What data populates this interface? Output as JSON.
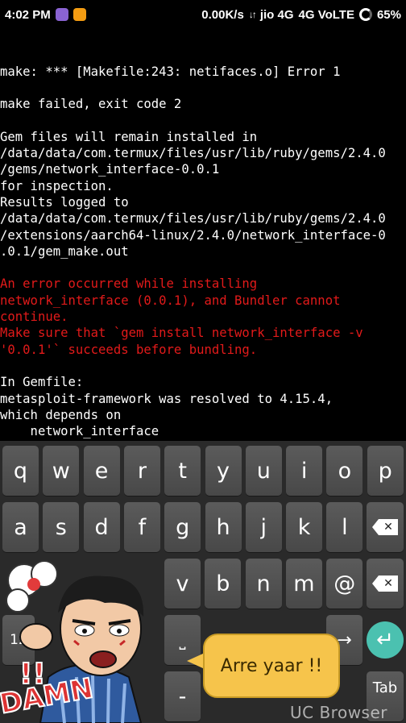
{
  "status_bar": {
    "time": "4:02 PM",
    "net_speed": "0.00K/s",
    "carrier": "jio 4G",
    "network": "4G VoLTE",
    "battery": "65%"
  },
  "terminal": {
    "lines": [
      {
        "text": "make: *** [Makefile:243: netifaces.o] Error 1",
        "style": "normal"
      },
      {
        "text": "",
        "style": "normal"
      },
      {
        "text": "make failed, exit code 2",
        "style": "normal"
      },
      {
        "text": "",
        "style": "normal"
      },
      {
        "text": "Gem files will remain installed in",
        "style": "normal"
      },
      {
        "text": "/data/data/com.termux/files/usr/lib/ruby/gems/2.4.0",
        "style": "normal"
      },
      {
        "text": "/gems/network_interface-0.0.1",
        "style": "normal"
      },
      {
        "text": "for inspection.",
        "style": "normal"
      },
      {
        "text": "Results logged to",
        "style": "normal"
      },
      {
        "text": "/data/data/com.termux/files/usr/lib/ruby/gems/2.4.0",
        "style": "normal"
      },
      {
        "text": "/extensions/aarch64-linux/2.4.0/network_interface-0",
        "style": "normal"
      },
      {
        "text": ".0.1/gem_make.out",
        "style": "normal"
      },
      {
        "text": "",
        "style": "normal"
      },
      {
        "text": "An error occurred while installing",
        "style": "error"
      },
      {
        "text": "network_interface (0.0.1), and Bundler cannot",
        "style": "error"
      },
      {
        "text": "continue.",
        "style": "error"
      },
      {
        "text": "Make sure that `gem install network_interface -v",
        "style": "error"
      },
      {
        "text": "'0.0.1'` succeeds before bundling.",
        "style": "error"
      },
      {
        "text": "",
        "style": "normal"
      },
      {
        "text": "In Gemfile:",
        "style": "normal"
      },
      {
        "text": "metasploit-framework was resolved to 4.15.4,",
        "style": "normal"
      },
      {
        "text": "which depends on",
        "style": "normal"
      },
      {
        "text": "    network_interface",
        "style": "normal"
      }
    ],
    "prompt": "$"
  },
  "keyboard": {
    "row1": [
      "q",
      "w",
      "e",
      "r",
      "t",
      "y",
      "u",
      "i",
      "o",
      "p"
    ],
    "row2": [
      "a",
      "s",
      "d",
      "f",
      "g",
      "h",
      "j",
      "k",
      "l"
    ],
    "row3": [
      "v",
      "b",
      "n",
      "m",
      "@"
    ],
    "row4_visible": [
      "12",
      "→"
    ],
    "row5_visible": [
      "-",
      "Tab"
    ]
  },
  "sticker": {
    "speech": "Arre yaar !!",
    "exclaim": "!!",
    "word": "DAMN"
  },
  "watermark": "UC Browser",
  "colors": {
    "terminal_bg": "#000000",
    "error_text": "#e21a1a",
    "key_bg": "#505050",
    "enter_accent": "#4bc1b0",
    "bubble": "#f6c44b"
  }
}
